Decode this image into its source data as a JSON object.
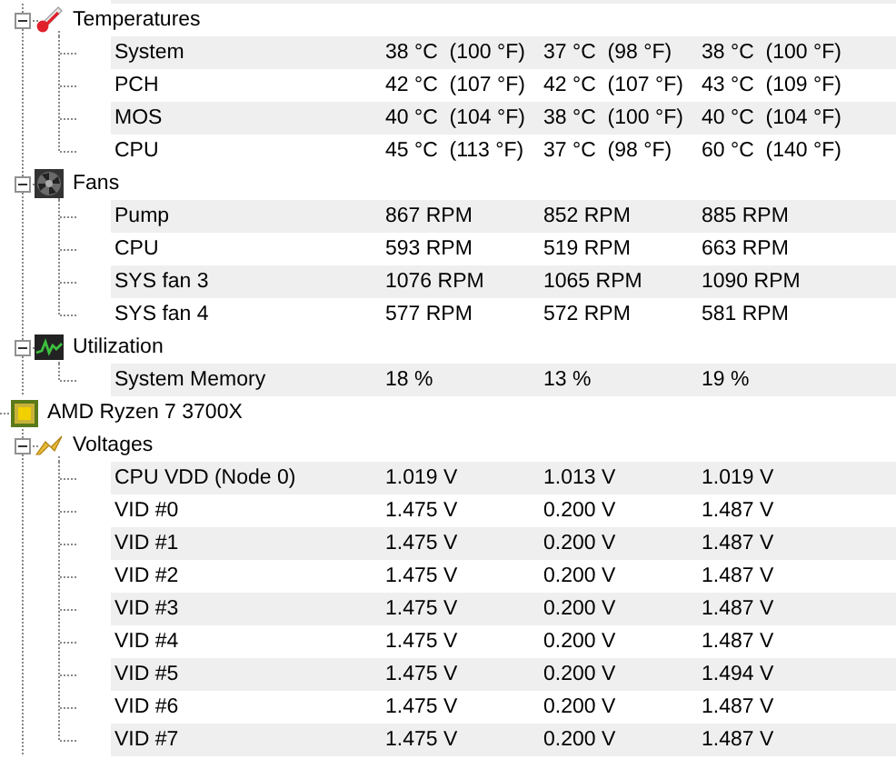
{
  "tree": [
    {
      "kind": "temperature",
      "label": "Temperatures",
      "expanded": true,
      "sensors": [
        {
          "name": "System",
          "values": [
            "38 °C  (100 °F)",
            "37 °C  (98 °F)",
            "38 °C  (100 °F)"
          ]
        },
        {
          "name": "PCH",
          "values": [
            "42 °C  (107 °F)",
            "42 °C  (107 °F)",
            "43 °C  (109 °F)"
          ]
        },
        {
          "name": "MOS",
          "values": [
            "40 °C  (104 °F)",
            "38 °C  (100 °F)",
            "40 °C  (104 °F)"
          ]
        },
        {
          "name": "CPU",
          "values": [
            "45 °C  (113 °F)",
            "37 °C  (98 °F)",
            "60 °C  (140 °F)"
          ]
        }
      ]
    },
    {
      "kind": "fan",
      "label": "Fans",
      "expanded": true,
      "sensors": [
        {
          "name": "Pump",
          "values": [
            "867 RPM",
            "852 RPM",
            "885 RPM"
          ]
        },
        {
          "name": "CPU",
          "values": [
            "593 RPM",
            "519 RPM",
            "663 RPM"
          ]
        },
        {
          "name": "SYS fan 3",
          "values": [
            "1076 RPM",
            "1065 RPM",
            "1090 RPM"
          ]
        },
        {
          "name": "SYS fan 4",
          "values": [
            "577 RPM",
            "572 RPM",
            "581 RPM"
          ]
        }
      ]
    },
    {
      "kind": "utilization",
      "label": "Utilization",
      "expanded": true,
      "sensors": [
        {
          "name": "System Memory",
          "values": [
            "18 %",
            "13 %",
            "19 %"
          ]
        }
      ]
    },
    {
      "kind": "device",
      "label": "AMD Ryzen 7 3700X"
    },
    {
      "kind": "voltage",
      "label": "Voltages",
      "expanded": true,
      "sensors": [
        {
          "name": "CPU VDD (Node 0)",
          "values": [
            "1.019 V",
            "1.013 V",
            "1.019 V"
          ]
        },
        {
          "name": "VID #0",
          "values": [
            "1.475 V",
            "0.200 V",
            "1.487 V"
          ]
        },
        {
          "name": "VID #1",
          "values": [
            "1.475 V",
            "0.200 V",
            "1.487 V"
          ]
        },
        {
          "name": "VID #2",
          "values": [
            "1.475 V",
            "0.200 V",
            "1.487 V"
          ]
        },
        {
          "name": "VID #3",
          "values": [
            "1.475 V",
            "0.200 V",
            "1.487 V"
          ]
        },
        {
          "name": "VID #4",
          "values": [
            "1.475 V",
            "0.200 V",
            "1.487 V"
          ]
        },
        {
          "name": "VID #5",
          "values": [
            "1.475 V",
            "0.200 V",
            "1.494 V"
          ]
        },
        {
          "name": "VID #6",
          "values": [
            "1.475 V",
            "0.200 V",
            "1.487 V"
          ]
        },
        {
          "name": "VID #7",
          "values": [
            "1.475 V",
            "0.200 V",
            "1.487 V"
          ]
        }
      ]
    }
  ]
}
